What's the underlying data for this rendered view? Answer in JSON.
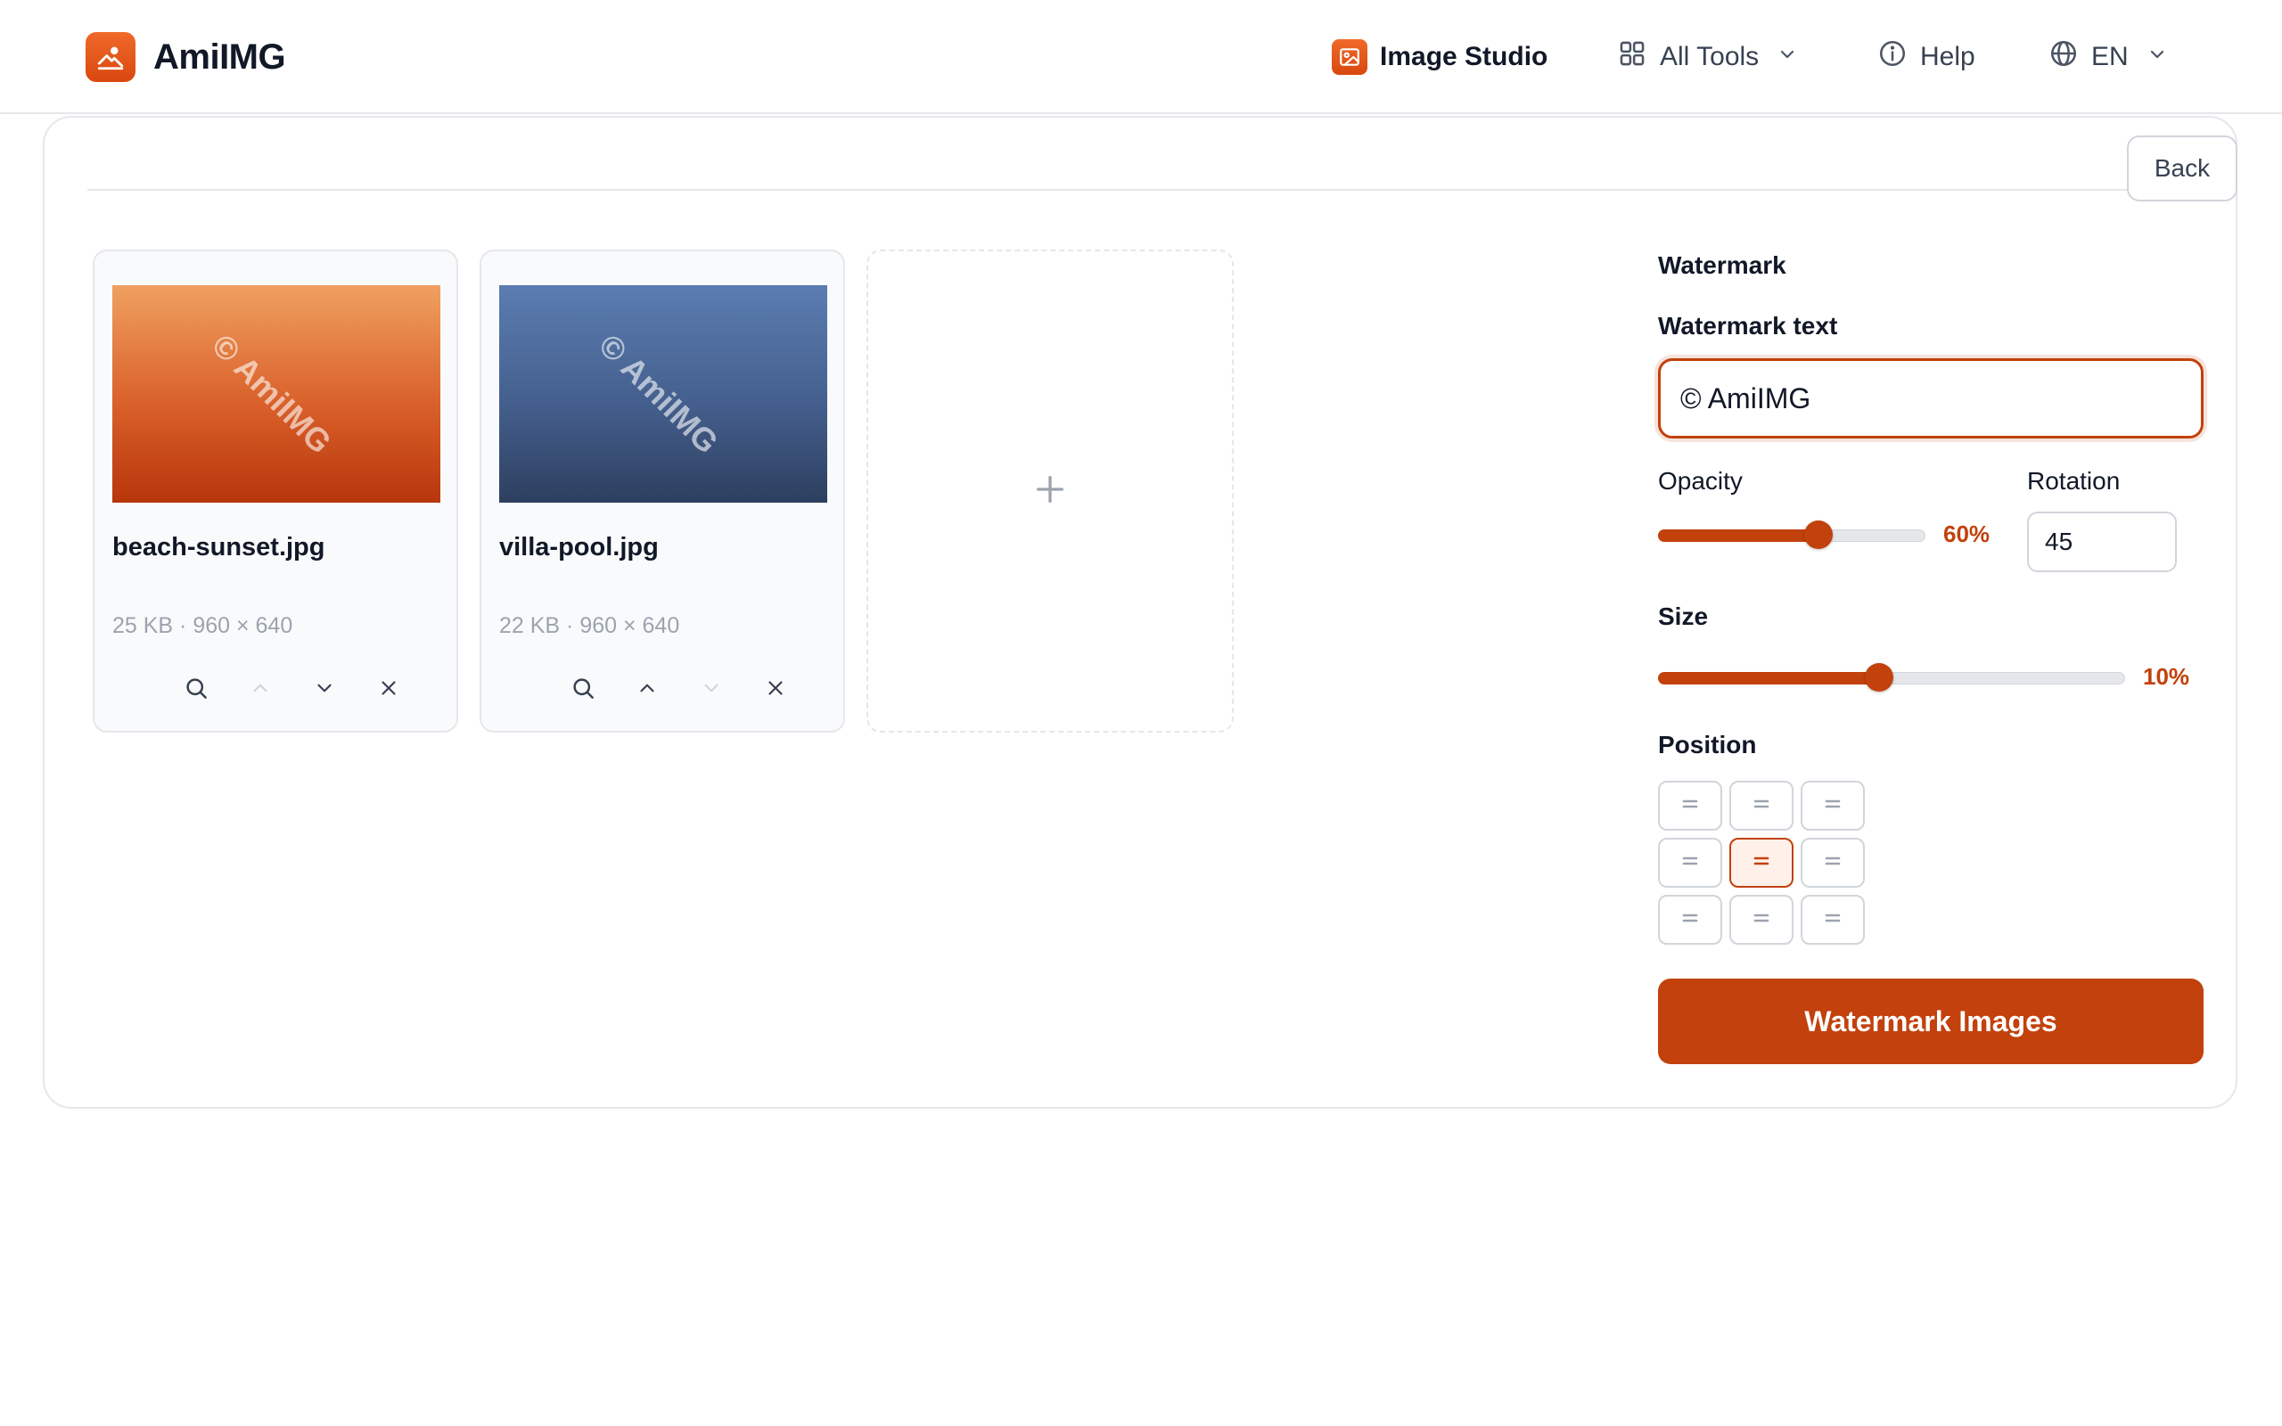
{
  "header": {
    "brand": "AmiIMG",
    "nav": {
      "studio": "Image Studio",
      "tools": "All Tools",
      "help": "Help",
      "language": "EN"
    }
  },
  "main": {
    "back_label": "Back",
    "images": [
      {
        "name": "beach-sunset.jpg",
        "meta": "25 KB · 960 × 640",
        "watermark_preview": "© AmiIMG"
      },
      {
        "name": "villa-pool.jpg",
        "meta": "22 KB · 960 × 640",
        "watermark_preview": "© AmiIMG"
      }
    ],
    "add_tile_symbol": "+"
  },
  "settings": {
    "section_title": "Watermark",
    "text_label": "Watermark text",
    "text_value": "© AmiIMG",
    "opacity_label": "Opacity",
    "opacity_value": 60,
    "opacity_display": "60%",
    "rotation_label": "Rotation",
    "rotation_value": "45",
    "size_label": "Size",
    "size_value": 10,
    "size_min": 1,
    "size_max": 20,
    "size_display": "10%",
    "position_label": "Position",
    "position_selected": "middle-center",
    "submit_label": "Watermark Images"
  },
  "colors": {
    "accent": "#c2410c",
    "accent_light": "#fff1ea",
    "border": "#e5e7eb",
    "muted_text": "#9ca3af"
  },
  "icons": {
    "brand": "mountain-photo-icon",
    "studio": "image-icon",
    "tools": "grid-icon",
    "help": "info-icon",
    "language": "globe-icon",
    "tile_actions": [
      "search-icon",
      "chevron-up-icon",
      "chevron-down-icon",
      "close-icon"
    ]
  }
}
